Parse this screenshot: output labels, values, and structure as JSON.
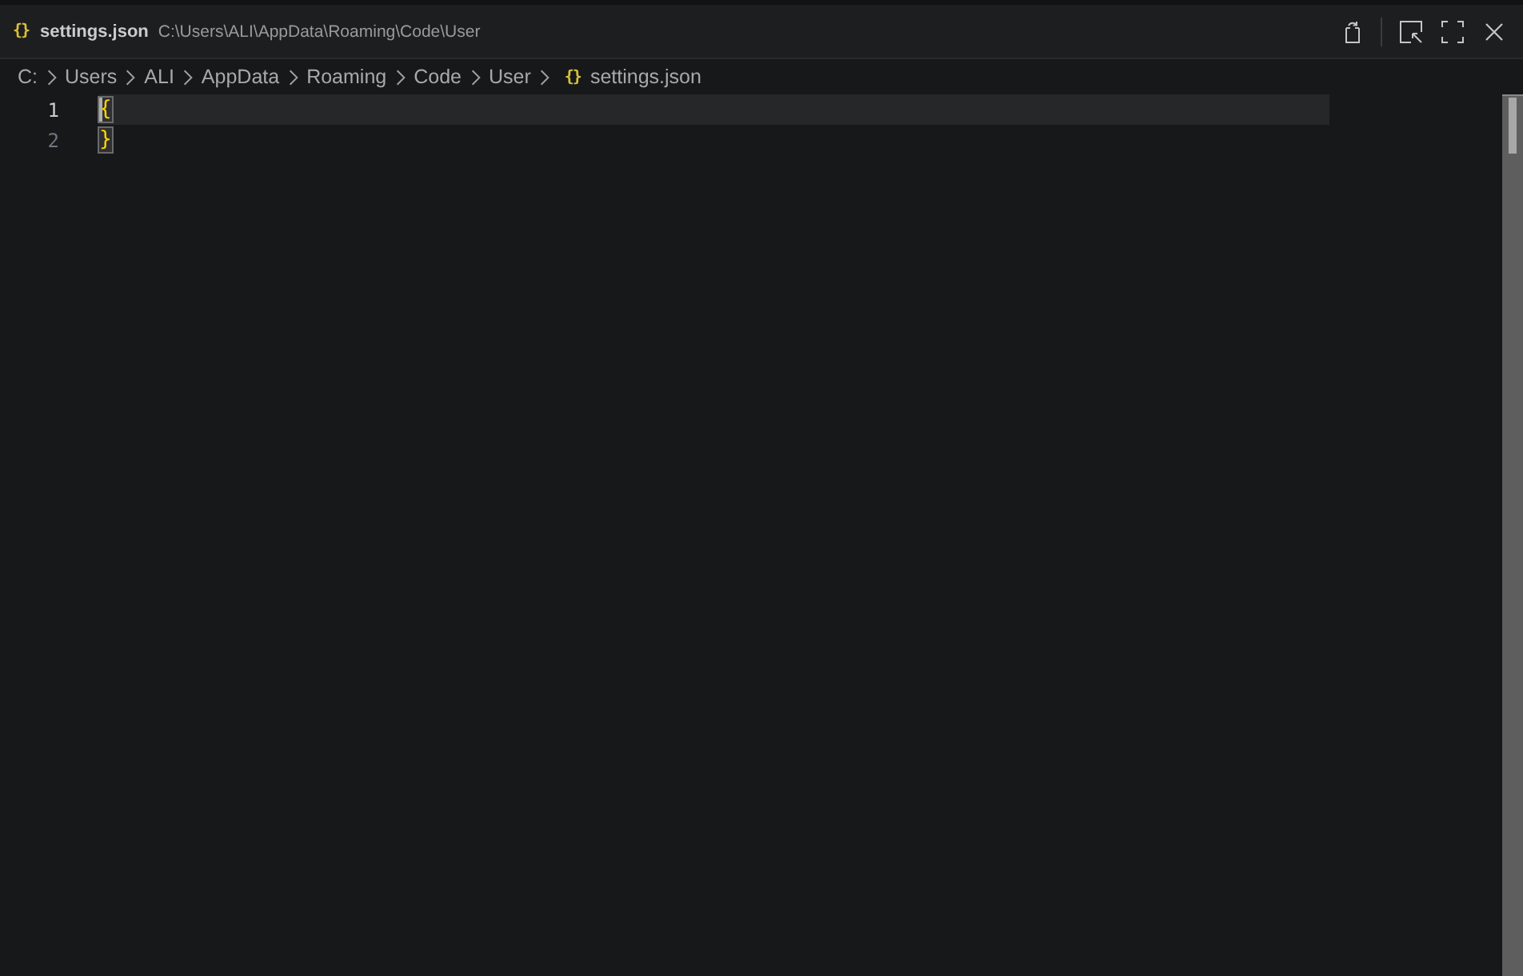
{
  "window": {
    "icon": "{}",
    "title": "settings.json",
    "path": "C:\\Users\\ALI\\AppData\\Roaming\\Code\\User"
  },
  "breadcrumbs": [
    {
      "kind": "folder",
      "label": "C:"
    },
    {
      "kind": "folder",
      "label": "Users"
    },
    {
      "kind": "folder",
      "label": "ALI"
    },
    {
      "kind": "folder",
      "label": "AppData"
    },
    {
      "kind": "folder",
      "label": "Roaming"
    },
    {
      "kind": "folder",
      "label": "Code"
    },
    {
      "kind": "folder",
      "label": "User"
    },
    {
      "kind": "file",
      "icon": "{}",
      "label": "settings.json"
    }
  ],
  "editor": {
    "lines": [
      {
        "number": "1",
        "text": "{",
        "current": true,
        "cursor": true,
        "matched": true
      },
      {
        "number": "2",
        "text": "}",
        "current": false,
        "cursor": false,
        "matched": true
      }
    ]
  }
}
